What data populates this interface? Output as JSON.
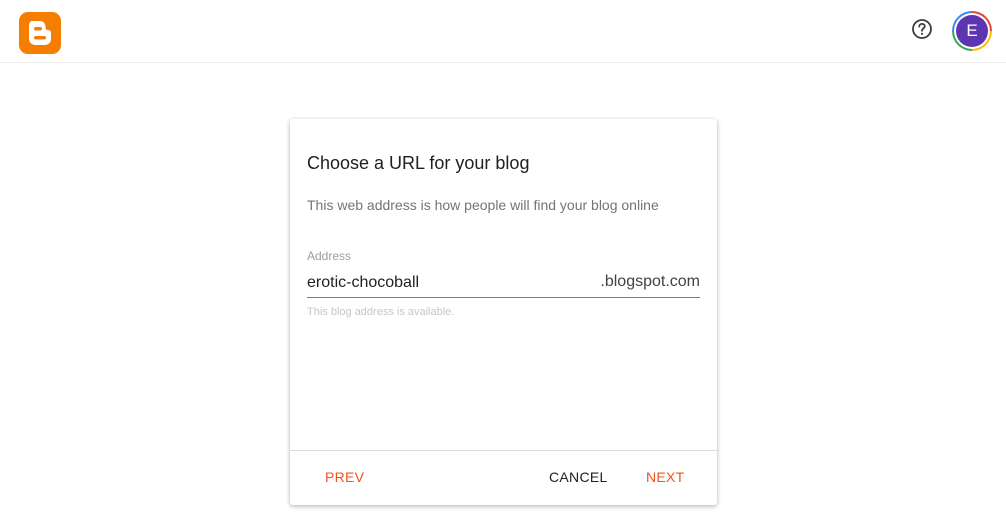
{
  "header": {
    "logo_icon": "blogger-logo-icon",
    "help_icon": "help-circle-icon",
    "avatar_initial": "E",
    "brand_color": "#f57d00",
    "avatar_color": "#5e35b1"
  },
  "dialog": {
    "title": "Choose a URL for your blog",
    "description": "This web address is how people will find your blog online",
    "address_label": "Address",
    "address_value": "erotic-chocoball",
    "address_suffix": ".blogspot.com",
    "address_hint": "This blog address is available.",
    "buttons": {
      "prev": "PREV",
      "cancel": "CANCEL",
      "next": "NEXT"
    },
    "accent_color": "#f4511e"
  }
}
